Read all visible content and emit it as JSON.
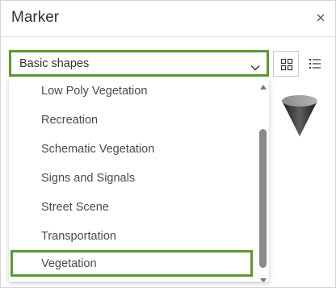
{
  "window": {
    "title": "Marker"
  },
  "style_select": {
    "value": "Basic shapes"
  },
  "dropdown": {
    "options": [
      "Low Poly Vegetation",
      "Recreation",
      "Schematic Vegetation",
      "Signs and Signals",
      "Street Scene",
      "Transportation",
      "Vegetation"
    ],
    "highlighted": "Vegetation"
  },
  "icons": {
    "close": "close-icon",
    "chevron": "chevron-down-icon",
    "grid_view": "grid-view-icon",
    "list_view": "list-view-icon",
    "symbol_preview": "cone-symbol"
  },
  "colors": {
    "highlight_border": "#5a9a2e",
    "text": "#323232"
  }
}
